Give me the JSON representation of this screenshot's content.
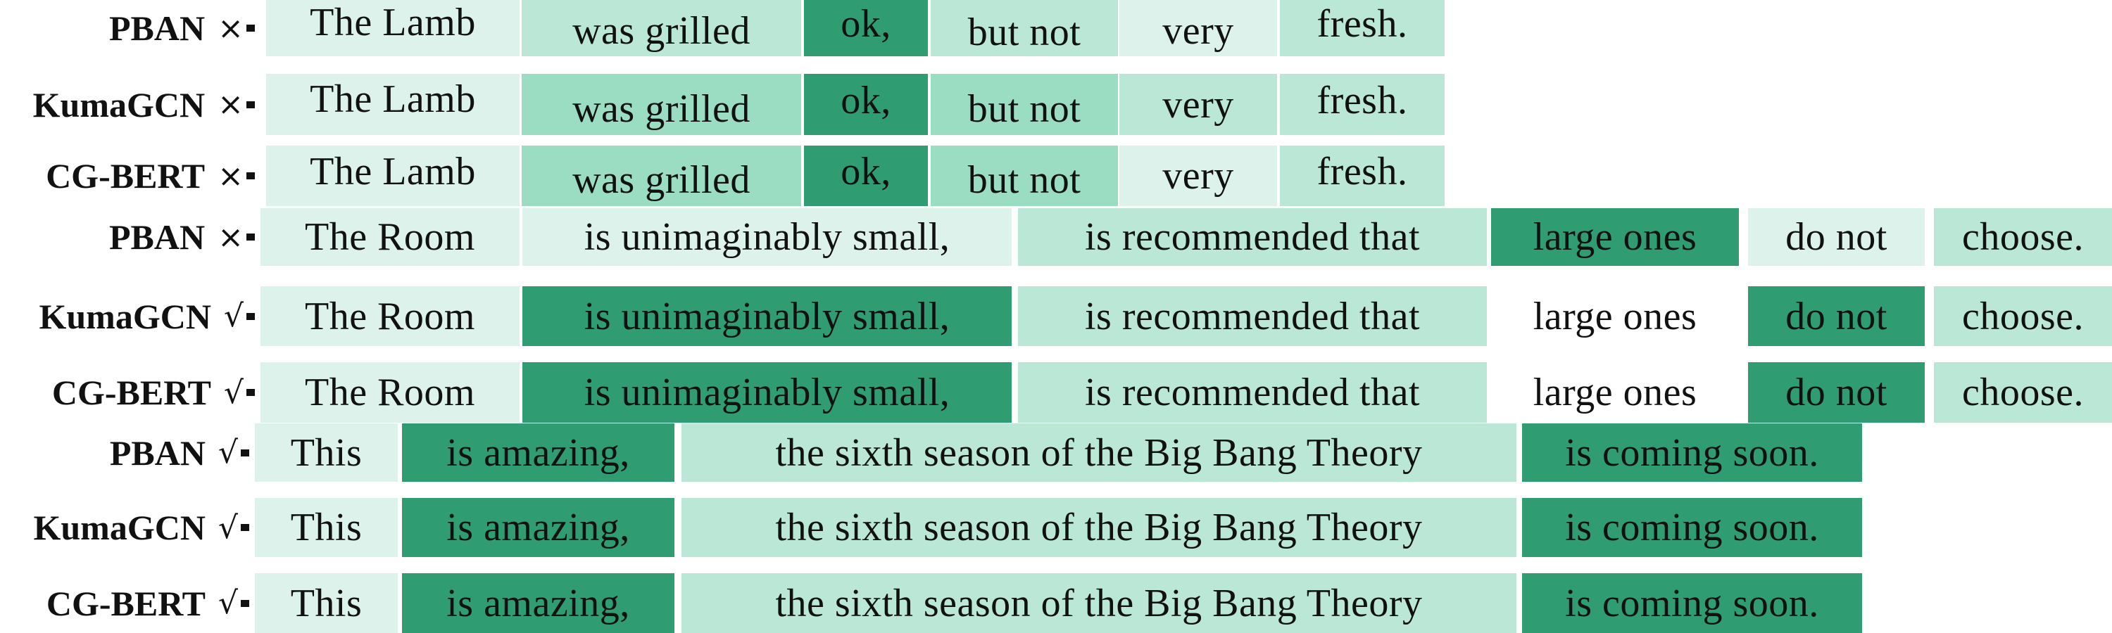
{
  "figure": {
    "description": "Attention visualization comparing PBAN, KumaGCN and CG-BERT on three example sentences",
    "palette": {
      "0": "#ffffff",
      "1": "#ddf2ea",
      "2": "#bbe8d6",
      "3": "#9bddc3",
      "4": "#2f9c72"
    },
    "level_meaning": "0 = no attention (white) … 4 = highest attention (dark green)"
  },
  "examples": [
    {
      "sentence_id": "lamb",
      "phrases": [
        "The Lamb",
        "was grilled",
        "ok,",
        "but not",
        "very",
        "fresh."
      ],
      "rows": [
        {
          "model": "PBAN",
          "mark": "×",
          "mark_name": "cross-icon",
          "levels": [
            1,
            2,
            4,
            2,
            1,
            2
          ]
        },
        {
          "model": "KumaGCN",
          "mark": "×",
          "mark_name": "cross-icon",
          "levels": [
            1,
            3,
            4,
            3,
            2,
            2
          ]
        },
        {
          "model": "CG-BERT",
          "mark": "×",
          "mark_name": "cross-icon",
          "levels": [
            1,
            3,
            4,
            3,
            1,
            2
          ]
        }
      ]
    },
    {
      "sentence_id": "room",
      "phrases": [
        "The Room",
        "is unimaginably small,",
        "is recommended that",
        "large ones",
        "do not",
        "choose."
      ],
      "rows": [
        {
          "model": "PBAN",
          "mark": "×",
          "mark_name": "cross-icon",
          "levels": [
            1,
            1,
            2,
            4,
            1,
            2
          ]
        },
        {
          "model": "KumaGCN",
          "mark": "√",
          "mark_name": "check-icon",
          "levels": [
            1,
            4,
            2,
            0,
            4,
            2
          ]
        },
        {
          "model": "CG-BERT",
          "mark": "√",
          "mark_name": "check-icon",
          "levels": [
            1,
            4,
            2,
            0,
            4,
            2
          ]
        }
      ]
    },
    {
      "sentence_id": "bigbang",
      "phrases": [
        "This",
        "is amazing,",
        "the sixth season of the Big Bang Theory",
        "is coming soon."
      ],
      "rows": [
        {
          "model": "PBAN",
          "mark": "√",
          "mark_name": "check-icon",
          "levels": [
            1,
            4,
            2,
            4
          ]
        },
        {
          "model": "KumaGCN",
          "mark": "√",
          "mark_name": "check-icon",
          "levels": [
            1,
            4,
            2,
            4
          ]
        },
        {
          "model": "CG-BERT",
          "mark": "√",
          "mark_name": "check-icon",
          "levels": [
            1,
            4,
            2,
            4
          ]
        }
      ]
    }
  ]
}
